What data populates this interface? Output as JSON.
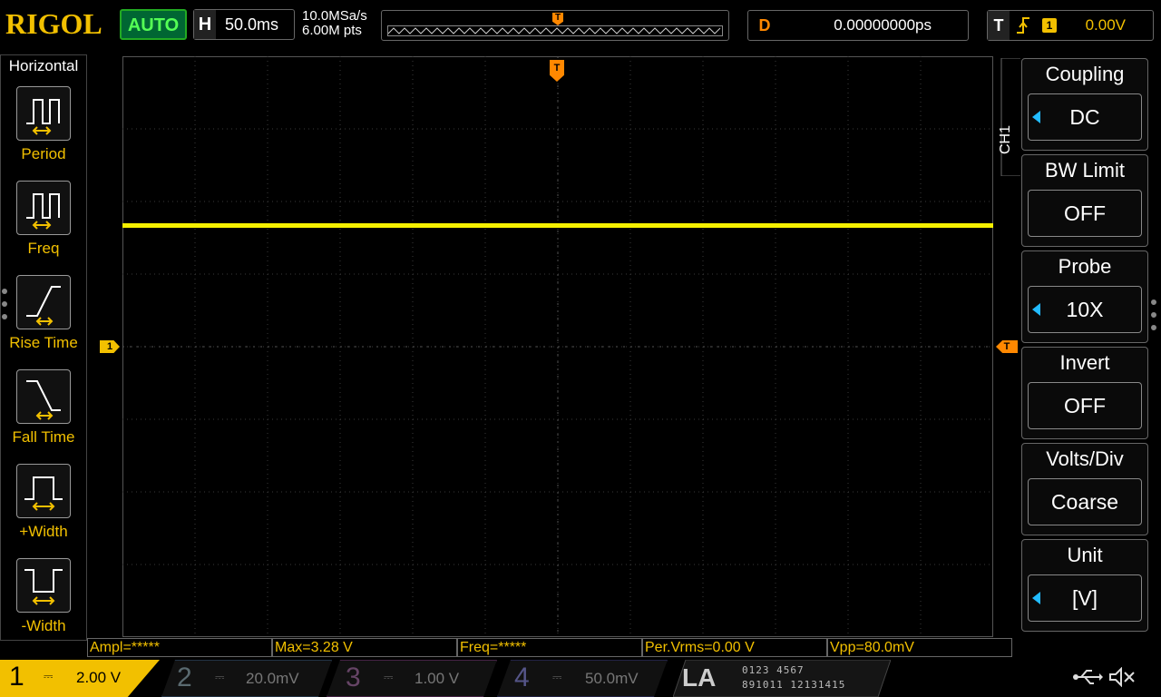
{
  "top_bar": {
    "brand": "RIGOL",
    "run_mode": "AUTO",
    "horizontal": {
      "label": "H",
      "timebase": "50.0ms"
    },
    "sample_rate": "10.0MSa/s",
    "memory_depth": "6.00M pts",
    "memory_trigger_marker": "T",
    "delay": {
      "label": "D",
      "value": "0.00000000ps"
    },
    "trigger": {
      "label": "T",
      "edge_icon": "rising-edge-icon",
      "source": "1",
      "level": "0.00V"
    }
  },
  "left_menu": {
    "title": "Horizontal",
    "items": [
      {
        "label": "Period",
        "icon": "period-icon"
      },
      {
        "label": "Freq",
        "icon": "frequency-icon"
      },
      {
        "label": "Rise Time",
        "icon": "rise-time-icon"
      },
      {
        "label": "Fall Time",
        "icon": "fall-time-icon"
      },
      {
        "label": "+Width",
        "icon": "positive-width-icon"
      },
      {
        "label": "-Width",
        "icon": "negative-width-icon"
      }
    ]
  },
  "screen": {
    "ch1_marker": "1",
    "trigger_marker": "T",
    "top_trigger_marker": "T",
    "trace_color": "#f5f000"
  },
  "right_menu": {
    "channel_tab": "CH1",
    "panels": [
      {
        "title": "Coupling",
        "value": "DC"
      },
      {
        "title": "BW Limit",
        "value": "OFF"
      },
      {
        "title": "Probe",
        "value": "10X"
      },
      {
        "title": "Invert",
        "value": "OFF"
      },
      {
        "title": "Volts/Div",
        "value": "Coarse"
      },
      {
        "title": "Unit",
        "value": "[V]"
      }
    ]
  },
  "measurements": [
    "Ampl=*****",
    "Max=3.28 V",
    "Freq=*****",
    "Per.Vrms=0.00 V",
    "Vpp=80.0mV"
  ],
  "channels": [
    {
      "num": "1",
      "scale": "2.00 V",
      "color": "#f2c000",
      "active": true
    },
    {
      "num": "2",
      "scale": "20.0mV",
      "color": "#2bf",
      "active": false
    },
    {
      "num": "3",
      "scale": "1.00 V",
      "color": "#d4f",
      "active": false
    },
    {
      "num": "4",
      "scale": "50.0mV",
      "color": "#36f",
      "active": false
    }
  ],
  "la": {
    "label": "LA",
    "bits_row1": "0123 4567",
    "bits_row2": "891011 12131415"
  },
  "status_icons": {
    "usb": "usb-icon",
    "sound": "mute-icon"
  }
}
